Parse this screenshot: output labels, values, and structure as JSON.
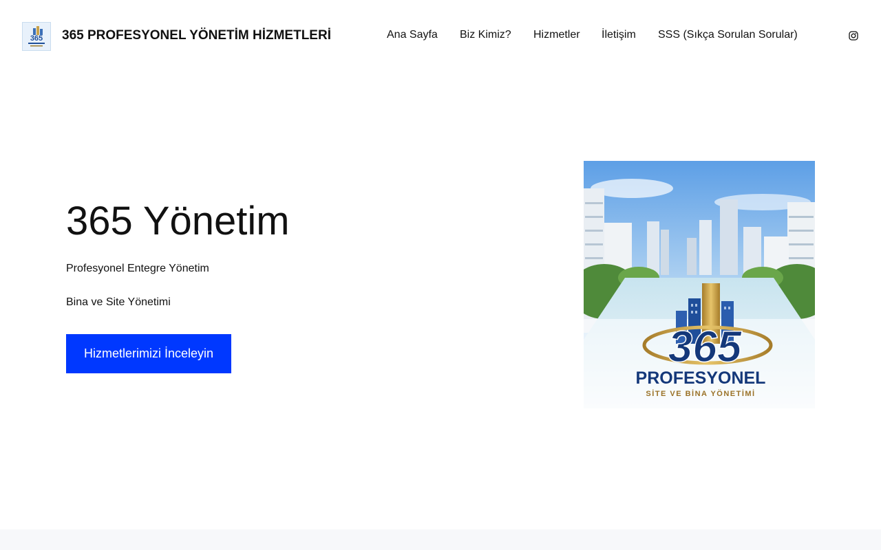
{
  "header": {
    "logo_icon": "company-logo-365",
    "site_title": "365 PROFESYONEL YÖNETİM HİZMETLERİ",
    "nav": [
      {
        "label": "Ana Sayfa"
      },
      {
        "label": "Biz Kimiz?"
      },
      {
        "label": "Hizmetler"
      },
      {
        "label": "İletişim"
      },
      {
        "label": "SSS (Sıkça Sorulan Sorular)"
      }
    ],
    "social_icon": "instagram-icon"
  },
  "hero": {
    "title": "365 Yönetim",
    "line1": "Profesyonel Entegre Yönetim",
    "line2": "Bina ve Site Yönetimi",
    "cta_label": "Hizmetlerimizi İnceleyin",
    "image": {
      "logo_number": "365",
      "brand": "PROFESYONEL",
      "tagline": "SİTE VE BİNA YÖNETİMİ"
    }
  },
  "colors": {
    "accent": "#0038ff",
    "text": "#111111",
    "footer_bg": "#f7f8fa"
  }
}
